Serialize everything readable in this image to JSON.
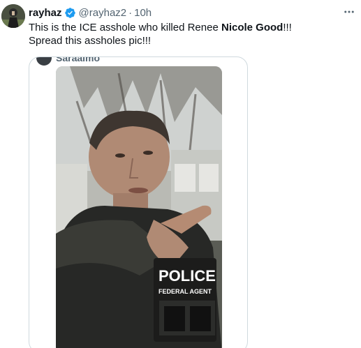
{
  "tweet": {
    "author_name": "rayhaz",
    "handle": "@rayhaz2",
    "separator": "·",
    "timestamp": "10h",
    "verified_icon": "verified-badge-icon",
    "more_icon": "more-horizontal-icon",
    "text_part1": "This is the ICE asshole who killed Renee ",
    "text_bold": "Nicole Good",
    "text_part2": "!!!",
    "text_line2": "Spread this assholes pic!!!"
  },
  "quoted_post": {
    "author_partial": "Saraaimo",
    "image_label": "Man in tactical jacket pointing",
    "vest_text_line1": "POLICE",
    "vest_text_line2": "FEDERAL AGENT"
  },
  "colors": {
    "text_primary": "#0f1419",
    "text_secondary": "#536471",
    "verified_blue": "#1d9bf0",
    "border": "#cfd9de"
  }
}
